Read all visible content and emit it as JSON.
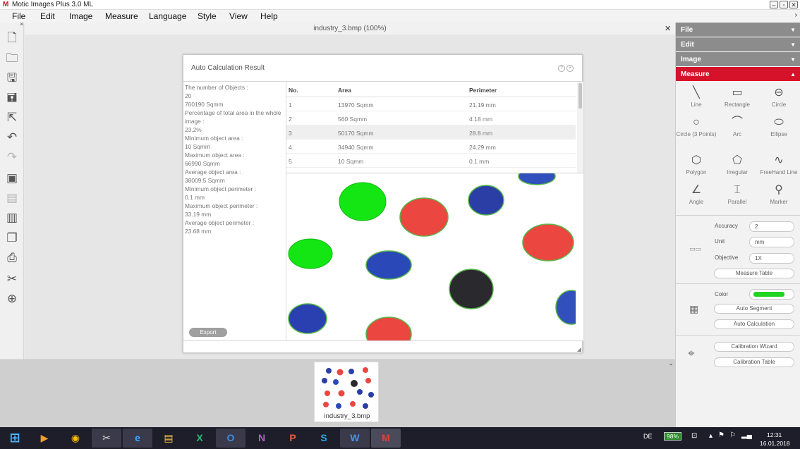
{
  "app": {
    "title": "Motic Images Plus 3.0 ML"
  },
  "menu": [
    "File",
    "Edit",
    "Image",
    "Measure",
    "Language",
    "Style",
    "View",
    "Help"
  ],
  "document": {
    "title": "industry_3.bmp (100%)",
    "thumbnail_label": "industry_3.bmp"
  },
  "dialog": {
    "title": "Auto Calculation Result",
    "export_label": "Export",
    "stats": [
      "The number of Objects :",
      "20",
      "760190 Sqmm",
      "Percentage of total area in the whole",
      "image :",
      "23.2%",
      "Minimum object area :",
      "10 Sqmm",
      "Maximum object area :",
      "66990 Sqmm",
      "Average object area :",
      "38009.5 Sqmm",
      "Minimum object perimeter :",
      "0.1 mm",
      "Maximum object perimeter :",
      "33.19 mm",
      "Average object perimeter :",
      "23.68 mm"
    ],
    "table": {
      "headers": [
        "No.",
        "Area",
        "Perimeter"
      ],
      "rows": [
        [
          "1",
          "13970 Sqmm",
          "21.19 mm"
        ],
        [
          "2",
          "560 Sqmm",
          "4.18 mm"
        ],
        [
          "3",
          "50170 Sqmm",
          "28.8 mm"
        ],
        [
          "4",
          "34940 Sqmm",
          "24.29 mm"
        ],
        [
          "5",
          "10 Sqmm",
          "0.1 mm"
        ]
      ]
    }
  },
  "right_panel": {
    "sections": [
      "File",
      "Edit",
      "Image",
      "Measure"
    ],
    "measure_tools": [
      {
        "label": "Line",
        "icon": "line-icon"
      },
      {
        "label": "Rectangle",
        "icon": "rectangle-icon"
      },
      {
        "label": "Circle",
        "icon": "circle-icon"
      },
      {
        "label": "Circle (3 Points)",
        "icon": "circle-3-points-icon"
      },
      {
        "label": "Arc",
        "icon": "arc-icon"
      },
      {
        "label": "Ellipse",
        "icon": "ellipse-icon"
      },
      {
        "label": "Polygon",
        "icon": "polygon-icon"
      },
      {
        "label": "Irregular",
        "icon": "irregular-icon"
      },
      {
        "label": "FreeHand Line",
        "icon": "freehand-line-icon"
      },
      {
        "label": "Angle",
        "icon": "angle-icon"
      },
      {
        "label": "Parallel",
        "icon": "parallel-icon"
      },
      {
        "label": "Marker",
        "icon": "marker-icon"
      }
    ],
    "settings": {
      "accuracy_label": "Accuracy",
      "accuracy_value": "2",
      "unit_label": "Unit",
      "unit_value": "mm",
      "objective_label": "Objective",
      "objective_value": "1X",
      "measure_table_label": "Measure Table",
      "color_label": "Color",
      "color_value": "#22d422",
      "auto_segment_label": "Auto Segment",
      "auto_calculation_label": "Auto Calculation",
      "calibration_wizard_label": "Calibration Wizard",
      "calibration_table_label": "Calibration Table"
    }
  },
  "taskbar": {
    "lang": "DE",
    "battery": "98%",
    "time": "12:31",
    "date": "16.01.2018"
  },
  "colors": {
    "accent": "#d6122b",
    "segment": "#22d422",
    "header_gray": "#8c8c8c"
  }
}
